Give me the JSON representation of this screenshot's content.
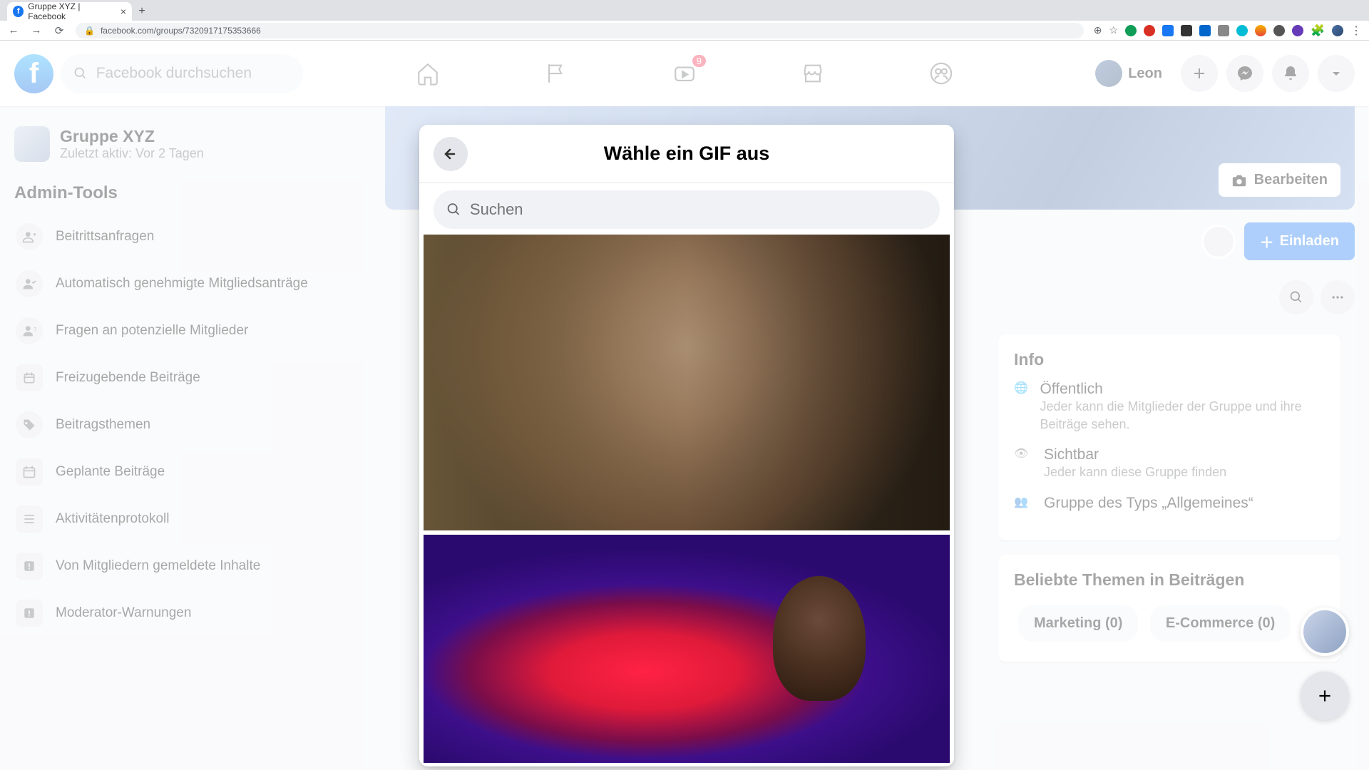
{
  "browser": {
    "tab_title": "Gruppe XYZ | Facebook",
    "url": "facebook.com/groups/7320917175353666",
    "new_tab": "+"
  },
  "fb_nav": {
    "search_placeholder": "Facebook durchsuchen",
    "watch_badge": "9",
    "profile_name": "Leon"
  },
  "sidebar": {
    "group_name": "Gruppe XYZ",
    "group_sub": "Zuletzt aktiv: Vor 2 Tagen",
    "section": "Admin-Tools",
    "items": [
      "Beitrittsanfragen",
      "Automatisch genehmigte Mitgliedsanträge",
      "Fragen an potenzielle Mitglieder",
      "Freizugebende Beiträge",
      "Beitragsthemen",
      "Geplante Beiträge",
      "Aktivitätenprotokoll",
      "Von Mitgliedern gemeldete Inhalte",
      "Moderator-Warnungen"
    ]
  },
  "cover": {
    "edit_label": "Bearbeiten"
  },
  "group_actions": {
    "invite_label": "Einladen"
  },
  "info_card": {
    "heading": "Info",
    "public_title": "Öffentlich",
    "public_sub": "Jeder kann die Mitglieder der Gruppe und ihre Beiträge sehen.",
    "visible_title": "Sichtbar",
    "visible_sub": "Jeder kann diese Gruppe finden",
    "type_title": "Gruppe des Typs „Allgemeines“"
  },
  "topics_card": {
    "heading": "Beliebte Themen in Beiträgen",
    "chips": [
      "Marketing (0)",
      "E-Commerce (0)"
    ]
  },
  "modal": {
    "title": "Wähle ein GIF aus",
    "search_placeholder": "Suchen"
  }
}
